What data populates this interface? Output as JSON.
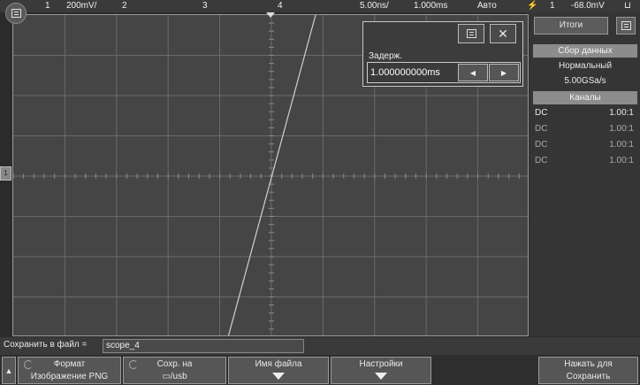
{
  "topbar": {
    "ch1_num": "1",
    "ch1_scale": "200mV/",
    "ch2_num": "2",
    "ch3_num": "3",
    "ch4_num": "4",
    "timebase": "5.00ns/",
    "delay": "1.000ms",
    "trigger_mode": "Авто",
    "trigger_source": "1",
    "trigger_level": "-68.0mV"
  },
  "delay_popup": {
    "label": "Задерж.",
    "value": "1.000000000ms"
  },
  "right_panel": {
    "tab_summary": "Итоги",
    "acquisition_header": "Сбор данных",
    "acq_mode": "Нормальный",
    "sample_rate": "5.00GSa/s",
    "channels_header": "Каналы",
    "channels": [
      {
        "coupling": "DC",
        "probe": "1.00:1"
      },
      {
        "coupling": "DC",
        "probe": "1.00:1"
      },
      {
        "coupling": "DC",
        "probe": "1.00:1"
      },
      {
        "coupling": "DC",
        "probe": "1.00:1"
      }
    ]
  },
  "save_row": {
    "label": "Сохранить в файл =",
    "filename": "scope_4"
  },
  "softkeys": {
    "format_title": "Формат",
    "format_value": "Изображение PNG",
    "save_to_title": "Сохр. на",
    "save_to_value": "▭/usb",
    "filename_title": "Имя файла",
    "settings_title": "Настройки",
    "press_save_line1": "Нажать для",
    "press_save_line2": "Сохранить"
  },
  "colors": {
    "screen_bg": "#454545",
    "grid_line": "#6a6a6a",
    "trace": "#d0d0d0"
  }
}
